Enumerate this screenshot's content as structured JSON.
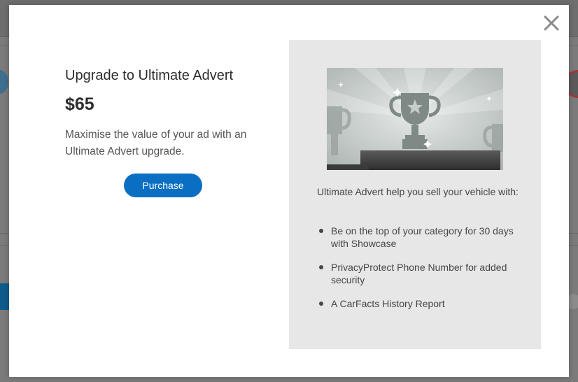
{
  "modal": {
    "title": "Upgrade to Ultimate Advert",
    "price": "$65",
    "description": "Maximise the value of your ad with an Ultimate Advert upgrade.",
    "purchase_label": "Purchase",
    "close_icon": "close-icon"
  },
  "panel": {
    "image_icon": "trophy-icon",
    "intro": "Ultimate Advert help you sell your vehicle with:",
    "features": [
      "Be on the top of your category for 30 days with Showcase",
      "PrivacyProtect Phone Number for added security",
      "A CarFacts History Report"
    ]
  },
  "colors": {
    "accent": "#0a6fc2",
    "panel_bg": "#e7e7e7",
    "overlay": "#7b7b7b"
  }
}
